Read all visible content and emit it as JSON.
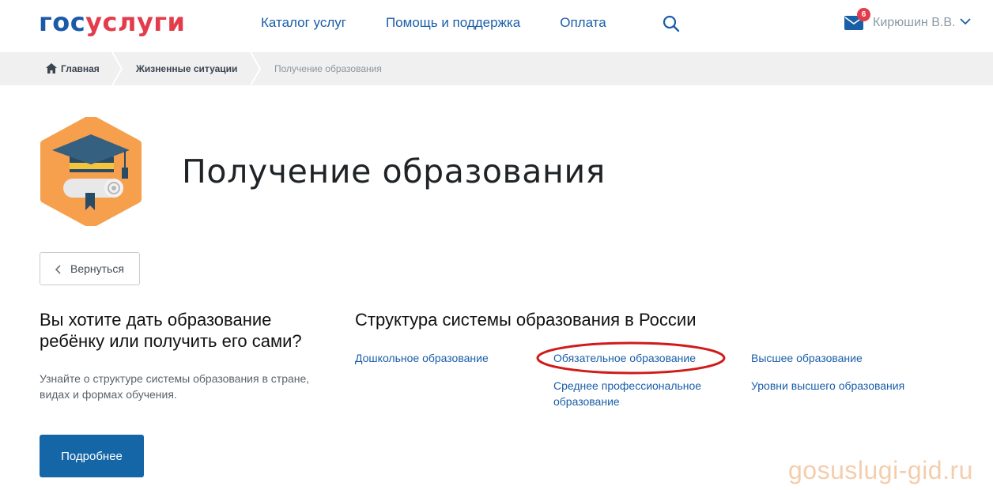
{
  "header": {
    "logo_part1": "гос",
    "logo_part2": "услуги",
    "nav": [
      "Каталог услуг",
      "Помощь и поддержка",
      "Оплата"
    ],
    "mail_count": "6",
    "user_name": "Кирюшин В.В."
  },
  "breadcrumb": {
    "home": "Главная",
    "life": "Жизненные ситуации",
    "current": "Получение образования"
  },
  "main": {
    "title": "Получение образования",
    "back_label": "Вернуться",
    "left_heading": "Вы хотите дать образование ребёнку или получить его сами?",
    "left_text": "Узнайте о структуре системы образования в стране, видах и формах обучения.",
    "more_label": "Подробнее",
    "right_heading": "Структура системы образования в России",
    "links": [
      "Дошкольное образование",
      "Обязательное образование",
      "Среднее профессиональное образование",
      "Высшее образование",
      "Уровни высшего образования"
    ]
  },
  "watermark": "gosuslugi-gid.ru",
  "colors": {
    "brand_blue": "#1c5aa8",
    "brand_red": "#e33c4b",
    "link": "#1a5ea8",
    "button": "#1566a7",
    "icon_bg": "#f6a04d"
  },
  "icons": [
    "search-icon",
    "mail-icon",
    "chevron-down-icon",
    "home-icon",
    "chevron-left-icon",
    "graduation-cap-icon"
  ]
}
